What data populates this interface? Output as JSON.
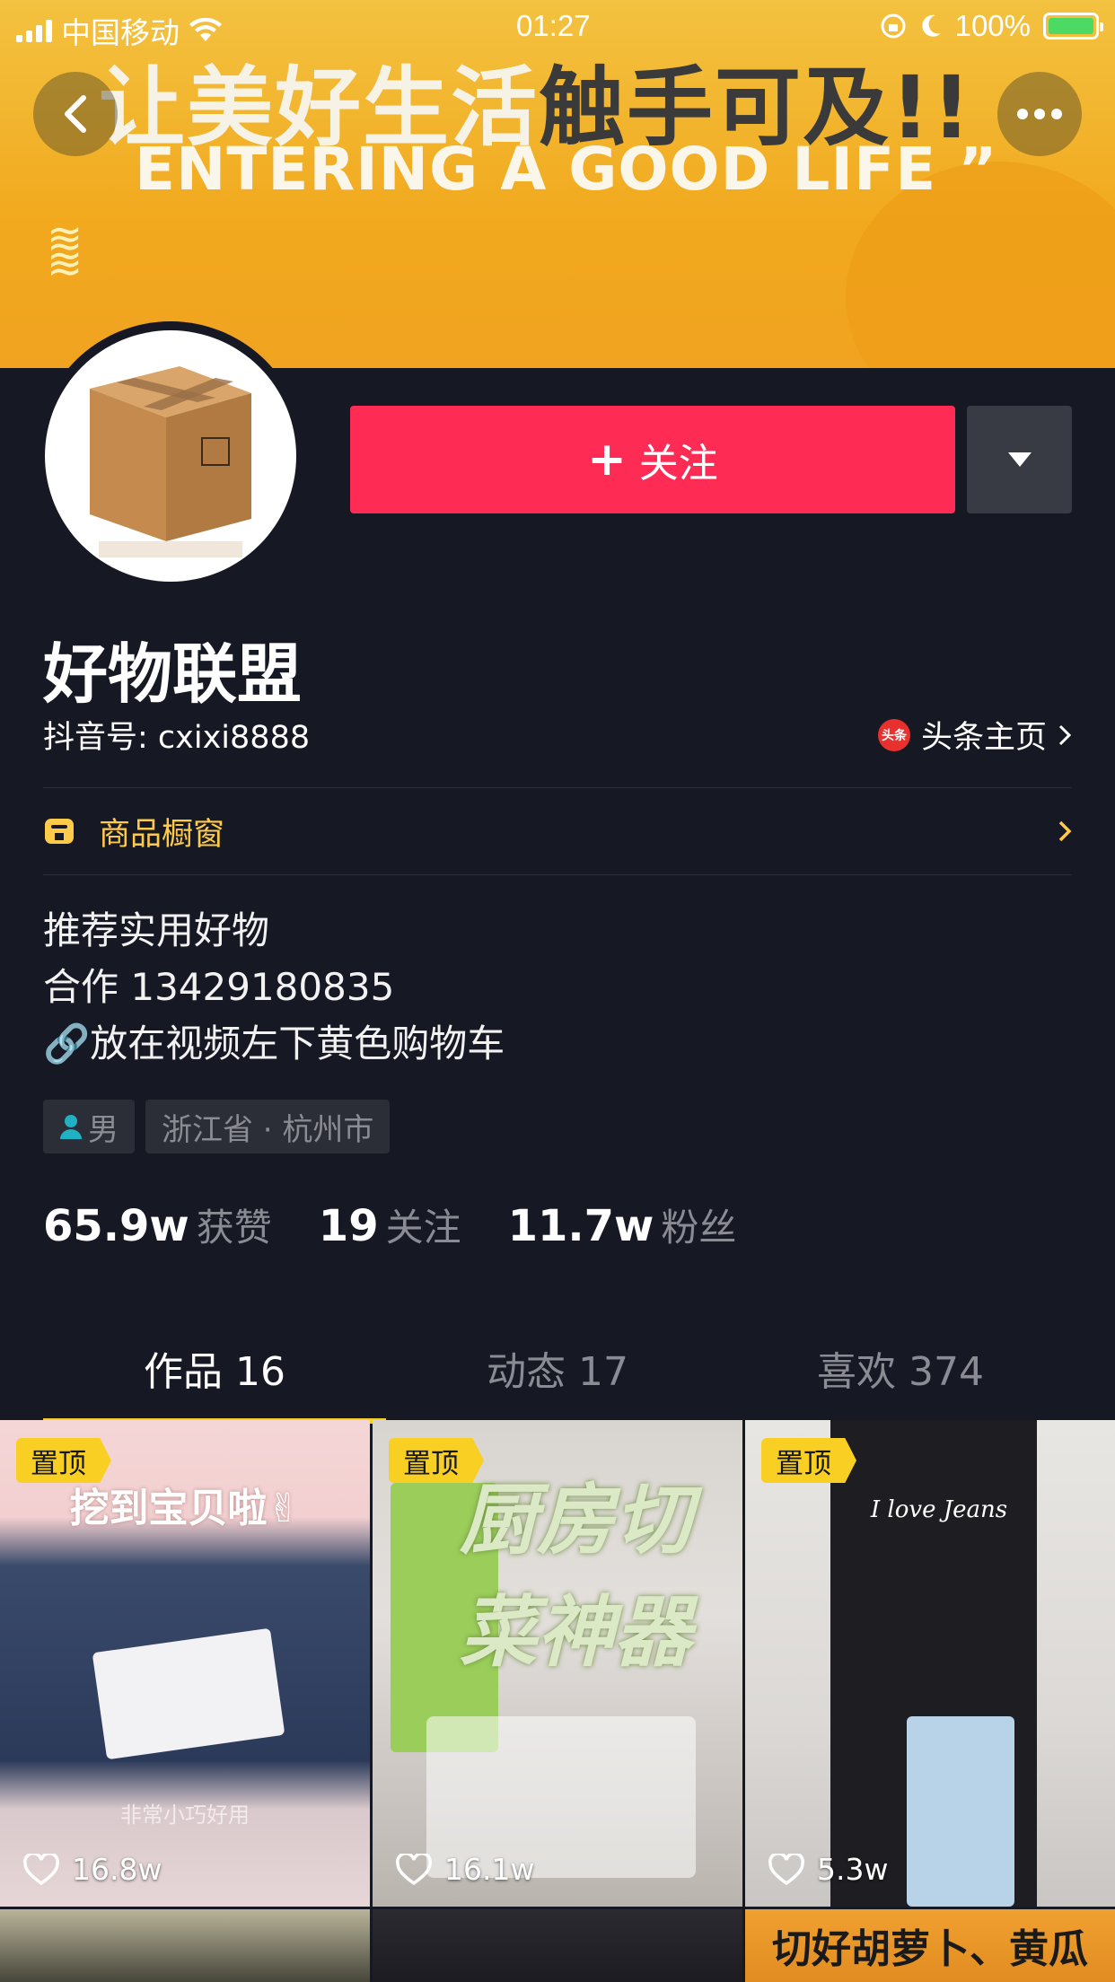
{
  "status_bar": {
    "carrier": "中国移动",
    "time": "01:27",
    "battery": "100%"
  },
  "banner": {
    "line1_white": "让美好生活",
    "line1_dark": "触手可及!!",
    "line2": "ENTERING A GOOD LIFE ”"
  },
  "profile": {
    "name": "好物联盟",
    "douyin_id": "抖音号: cxixi8888",
    "toutiao_link": "头条主页",
    "toutiao_logo": "头条",
    "follow_label": "关注",
    "shop_window": "商品橱窗",
    "bio": [
      "推荐实用好物",
      "合作 13429180835",
      "🔗放在视频左下黄色购物车"
    ],
    "tags": {
      "gender": "男",
      "location": "浙江省 · 杭州市"
    },
    "stats": [
      {
        "num": "65.9w",
        "label": "获赞"
      },
      {
        "num": "19",
        "label": "关注"
      },
      {
        "num": "11.7w",
        "label": "粉丝"
      }
    ]
  },
  "tabs": [
    {
      "label": "作品 16",
      "active": true
    },
    {
      "label": "动态 17",
      "active": false
    },
    {
      "label": "喜欢 374",
      "active": false
    }
  ],
  "videos": [
    {
      "pinned": "置顶",
      "likes": "16.8w",
      "caption": "挖到宝贝啦✌",
      "sub": "非常小巧好用"
    },
    {
      "pinned": "置顶",
      "likes": "16.1w",
      "caption": "厨房切菜神器"
    },
    {
      "pinned": "置顶",
      "likes": "5.3w",
      "caption": "I love Jeans"
    },
    {
      "caption": ""
    },
    {
      "caption": ""
    },
    {
      "caption": "切好胡萝卜、黄瓜"
    }
  ],
  "colors": {
    "background": "#161823",
    "follow_red": "#fe2c55",
    "accent_yellow": "#facf24",
    "muted_text": "#8a8b93"
  }
}
